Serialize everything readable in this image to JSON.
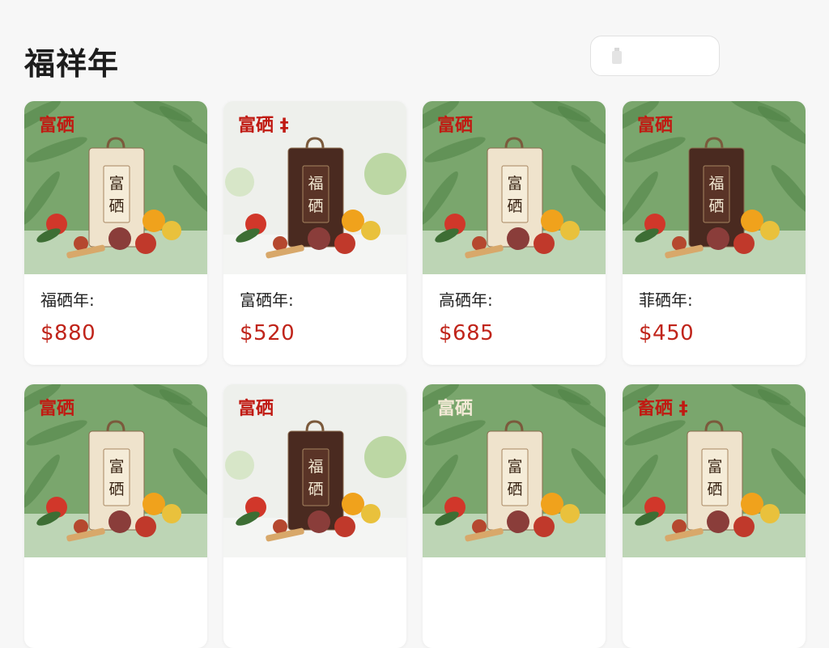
{
  "header": {
    "title": "福祥年"
  },
  "search": {
    "icon": "bottle-icon"
  },
  "products": [
    {
      "brand": "富硒",
      "name": "福硒年:",
      "price": "$880",
      "bag_text": "富硒",
      "bag_color": "#efe3cc",
      "background": "bamboo"
    },
    {
      "brand": "富硒 ‡",
      "name": "富硒年:",
      "price": "$520",
      "bag_text": "福硒",
      "bag_color": "#4a2a20",
      "background": "light"
    },
    {
      "brand": "富硒",
      "name": "高硒年:",
      "price": "$685",
      "bag_text": "富硒",
      "bag_color": "#efe3cc",
      "background": "bamboo"
    },
    {
      "brand": "富硒",
      "name": "菲硒年:",
      "price": "$450",
      "bag_text": "福硒",
      "bag_color": "#4a2a20",
      "background": "bamboo"
    },
    {
      "brand": "富硒",
      "name": "",
      "price": "",
      "bag_text": "富硒",
      "bag_color": "#efe3cc",
      "background": "bamboo"
    },
    {
      "brand": "富硒",
      "name": "",
      "price": "",
      "bag_text": "福硒",
      "bag_color": "#4a2a20",
      "background": "light"
    },
    {
      "brand": "富硒",
      "name": "",
      "price": "",
      "bag_text": "富硒",
      "bag_color": "#efe3cc",
      "background": "bamboo"
    },
    {
      "brand": "畜硒 ‡",
      "name": "",
      "price": "",
      "bag_text": "富硒",
      "bag_color": "#efe3cc",
      "background": "bamboo"
    }
  ],
  "colors": {
    "accent": "#c0241a",
    "bamboo_green": "#6e9c63",
    "card_bg": "#ffffff"
  }
}
